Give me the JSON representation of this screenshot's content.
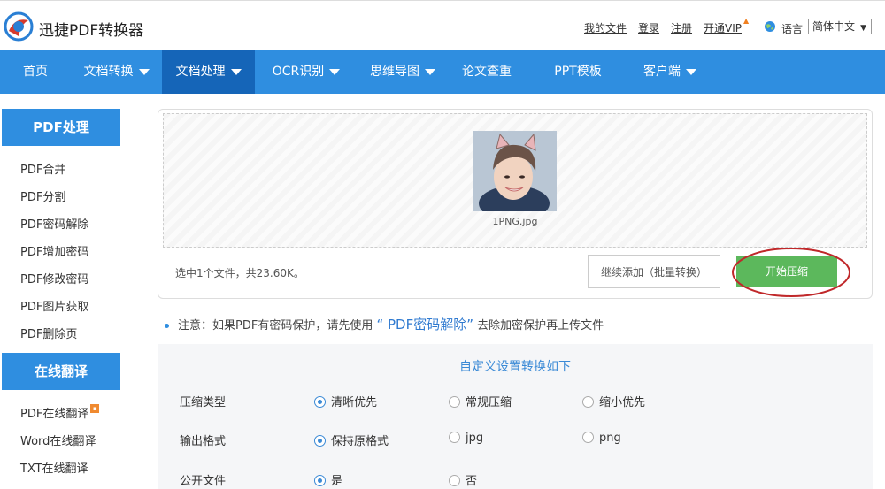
{
  "header": {
    "brand": "迅捷PDF转换器",
    "links": [
      "我的文件",
      "登录",
      "注册",
      "开通VIP"
    ],
    "language_label": "语言",
    "language_value": "简体中文"
  },
  "nav": {
    "items": [
      {
        "label": "首页"
      },
      {
        "label": "文档转换"
      },
      {
        "label": "文档处理"
      },
      {
        "label": "OCR识别"
      },
      {
        "label": "思维导图"
      },
      {
        "label": "论文查重"
      },
      {
        "label": "PPT模板"
      },
      {
        "label": "客户端"
      }
    ],
    "active": "文档处理"
  },
  "sidebar": {
    "sections": [
      {
        "title": "PDF处理",
        "items": [
          "PDF合并",
          "PDF分割",
          "PDF密码解除",
          "PDF增加密码",
          "PDF修改密码",
          "PDF图片获取",
          "PDF删除页"
        ]
      },
      {
        "title": "在线翻译",
        "items": [
          "PDF在线翻译",
          "Word在线翻译",
          "TXT在线翻译"
        ]
      }
    ]
  },
  "upload": {
    "file_name": "1PNG.jpg",
    "selection_info": "选中1个文件，共23.60K。",
    "add_button": "继续添加（批量转换）",
    "start_button": "开始压缩"
  },
  "notice": {
    "prefix": "注意：如果PDF有密码保护，请先使用",
    "link": "“ PDF密码解除”",
    "suffix": "去除加密保护再上传文件"
  },
  "settings": {
    "title": "自定义设置转换如下",
    "rows": [
      {
        "label": "压缩类型",
        "options": [
          "清晰优先",
          "常规压缩",
          "缩小优先"
        ],
        "selected": 0
      },
      {
        "label": "输出格式",
        "options": [
          "保持原格式",
          "jpg",
          "png"
        ],
        "selected": 0
      },
      {
        "label": "公开文件",
        "options": [
          "是",
          "否"
        ],
        "selected": 0
      }
    ]
  },
  "colors": {
    "nav_blue": "#2f8ee0",
    "nav_active": "#1565b8",
    "start_green": "#5cb85c",
    "highlight_ring": "#c0282a"
  }
}
